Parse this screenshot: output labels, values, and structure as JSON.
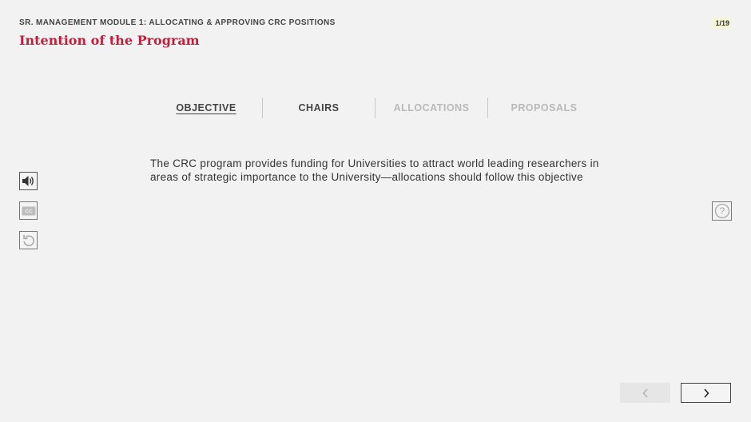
{
  "header": {
    "module_title": "SR. MANAGEMENT MODULE 1: ALLOCATING & APPROVING CRC POSITIONS",
    "page_title": "Intention of the Program",
    "page_counter": "1/19"
  },
  "tabs": [
    {
      "label": "OBJECTIVE",
      "state": "active"
    },
    {
      "label": "CHAIRS",
      "state": "visited"
    },
    {
      "label": "ALLOCATIONS",
      "state": "locked"
    },
    {
      "label": "PROPOSALS",
      "state": "locked"
    }
  ],
  "content": {
    "body": "The CRC program provides funding for Universities to attract world leading researchers in areas of strategic importance to the University—allocations should follow this objective"
  },
  "controls": {
    "left": [
      "speaker-icon",
      "closed-captions-icon",
      "replay-icon"
    ],
    "right": [
      "help-icon"
    ],
    "nav": [
      "chevron-left-icon",
      "chevron-right-icon"
    ]
  },
  "colors": {
    "accent": "#c41e3a",
    "background": "#f2f2f2",
    "disabled": "#b9b9b9"
  }
}
